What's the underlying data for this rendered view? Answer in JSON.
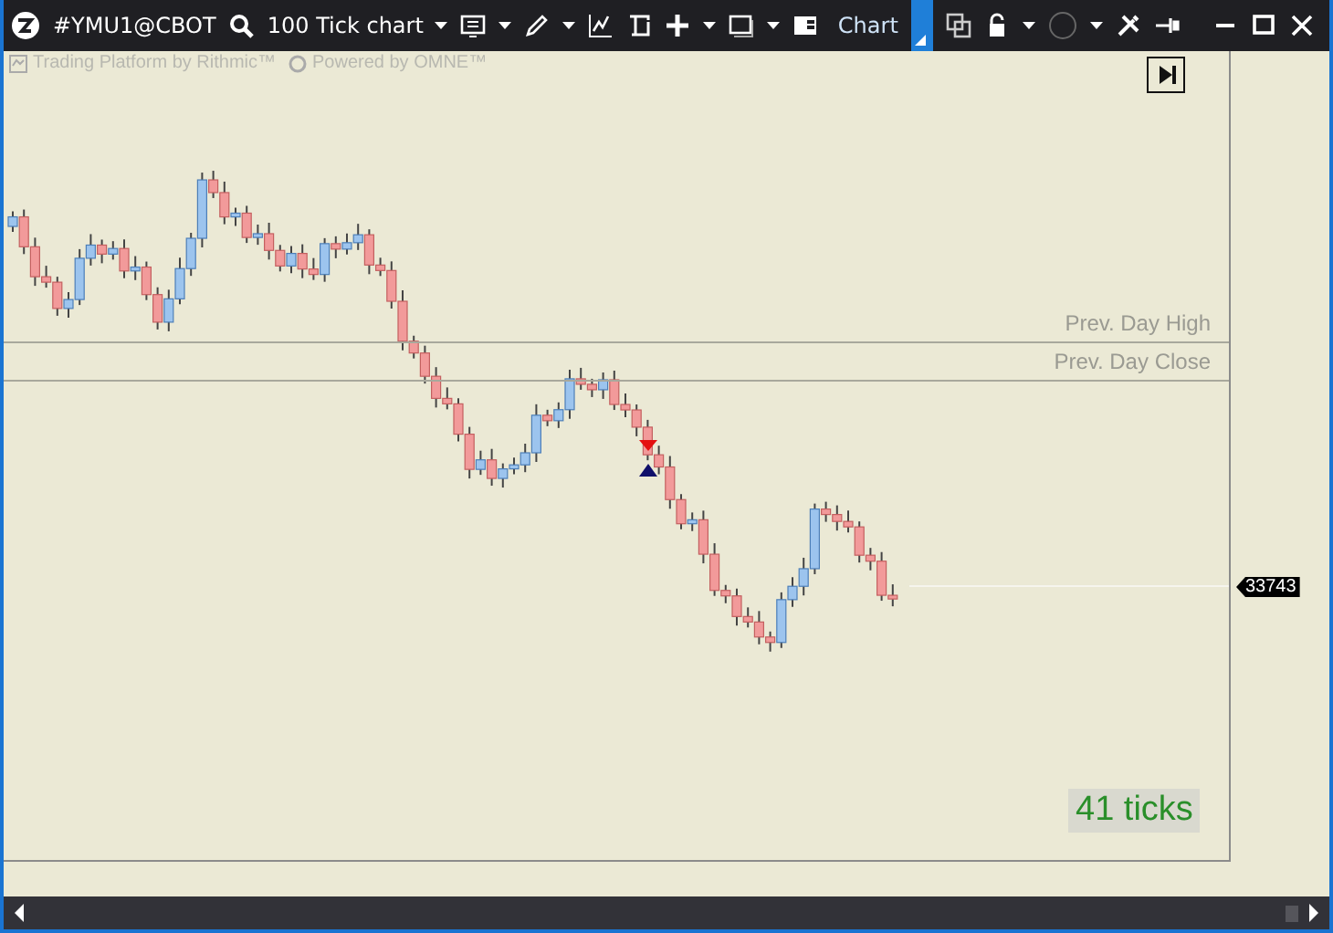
{
  "toolbar": {
    "symbol": "#YMU1@CBOT",
    "chart_type": "100 Tick chart",
    "label": "Chart"
  },
  "branding": [
    "Trading Platform by Rithmic™",
    "Powered by OMNE™"
  ],
  "levels": [
    {
      "label": "Prev. Day High"
    },
    {
      "label": "Prev. Day Close"
    }
  ],
  "price_tag": "33743",
  "tick_counter": "41 ticks"
}
